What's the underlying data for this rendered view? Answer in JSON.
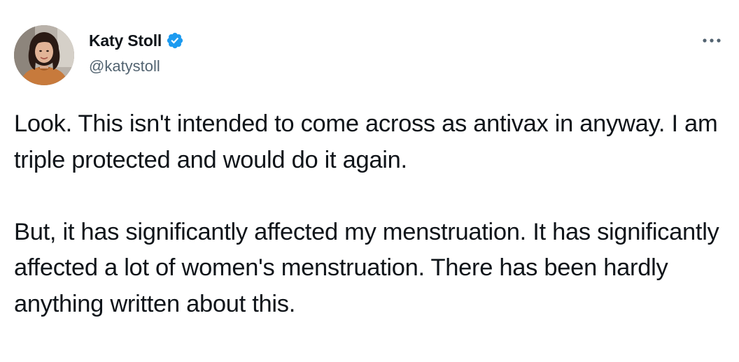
{
  "author": {
    "display_name": "Katy Stoll",
    "handle": "@katystoll",
    "verified": true,
    "verified_color": "#1d9bf0"
  },
  "tweet": {
    "paragraphs": [
      "Look. This isn't intended to come across as antivax in anyway. I am triple protected and would do it again.",
      "But, it has significantly affected my menstruation. It has significantly affected a lot of women's menstruation. There has been hardly anything written about this."
    ]
  },
  "icons": {
    "verified": "verified-badge-icon",
    "more": "more-options-icon"
  }
}
